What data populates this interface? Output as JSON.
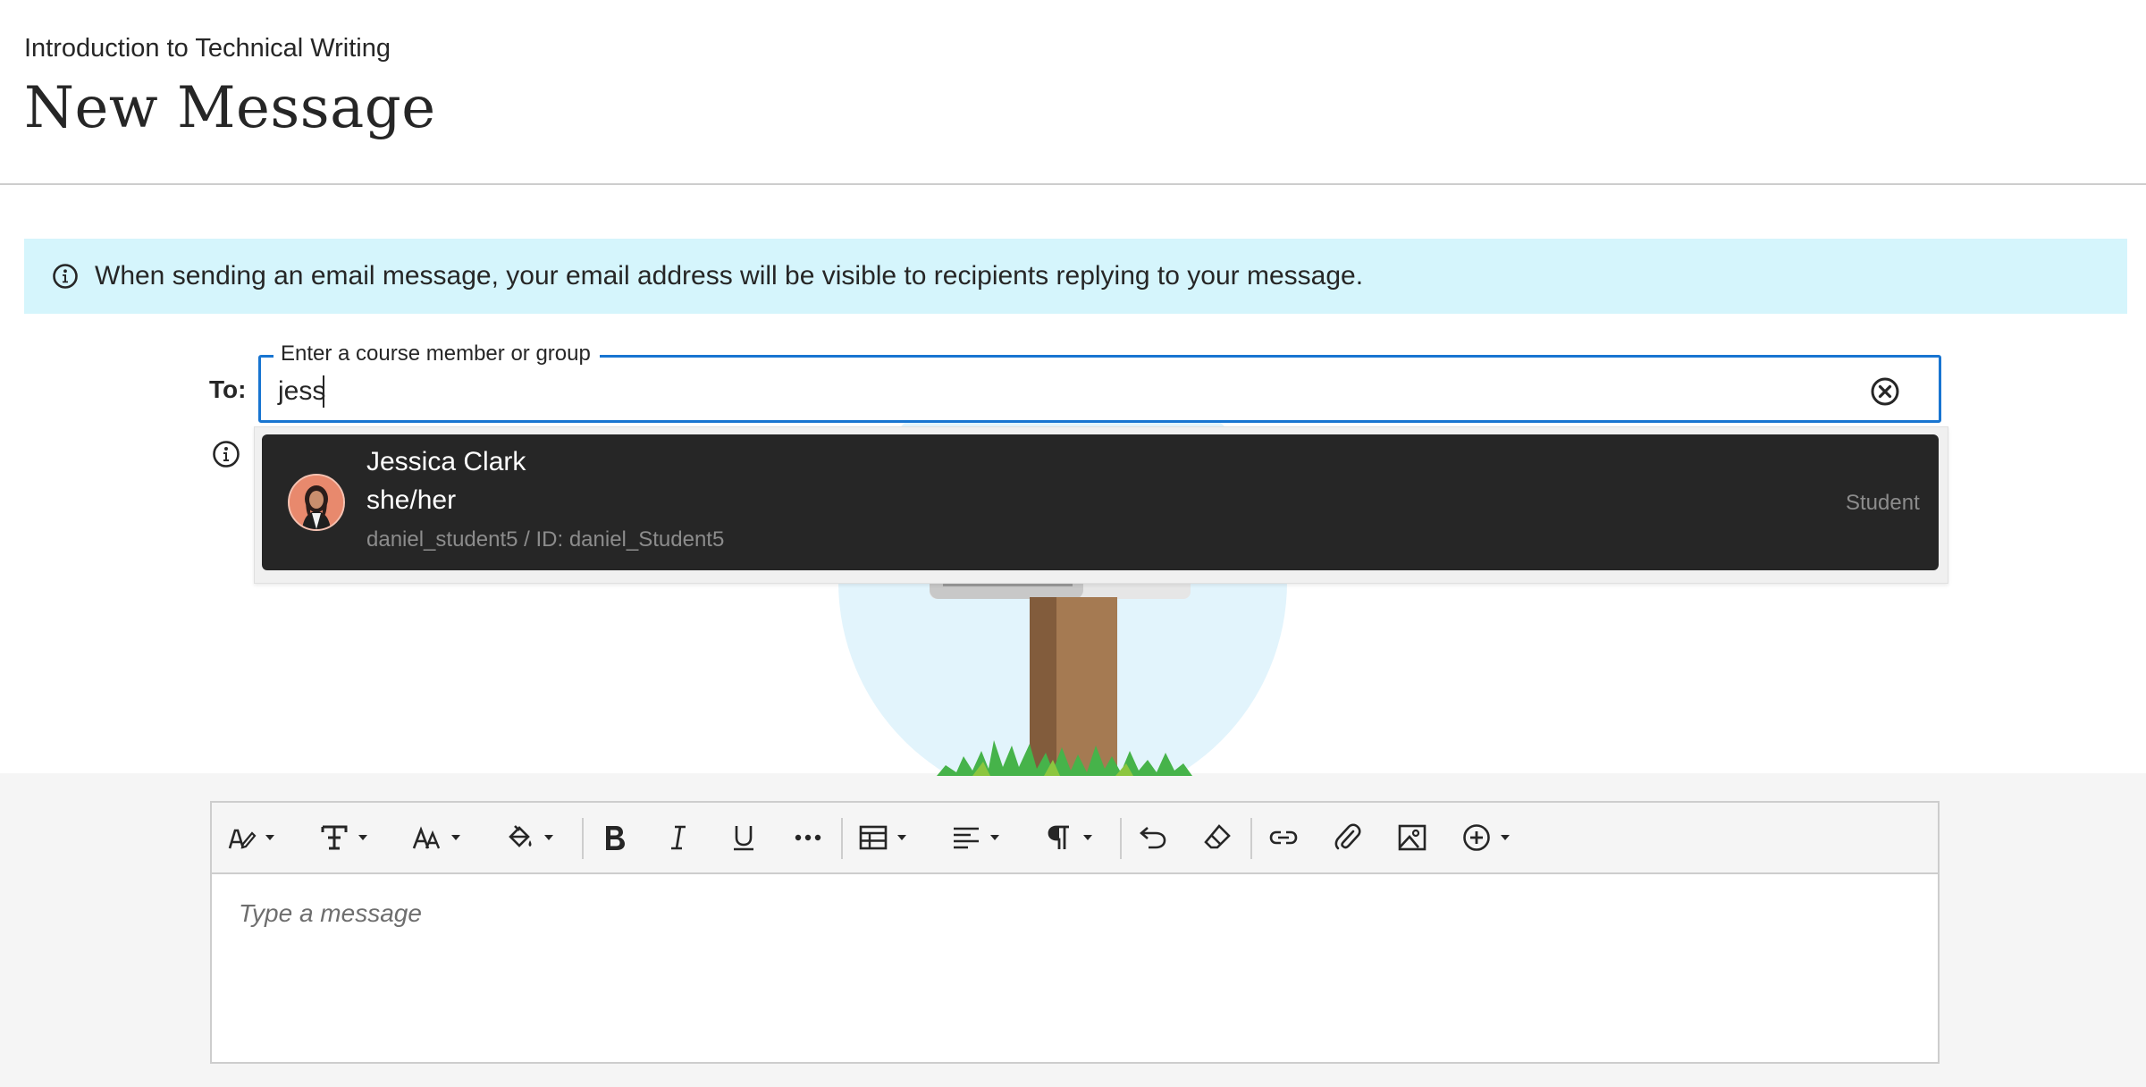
{
  "header": {
    "course_name": "Introduction to Technical Writing",
    "title": "New Message"
  },
  "notice": {
    "icon": "info-icon",
    "text": "When sending an email message, your email address will be visible to recipients replying to your message."
  },
  "recipient": {
    "label": "To:",
    "legend": "Enter a course member or group",
    "value": "jess",
    "clear_icon": "clear-circle-icon"
  },
  "suggestions": [
    {
      "name": "Jessica Clark",
      "pronouns": "she/her",
      "username": "daniel_student5 / ID: daniel_Student5",
      "role": "Student"
    }
  ],
  "editor": {
    "placeholder": "Type a message",
    "toolbar": [
      "text-style-icon",
      "text-format-icon",
      "font-size-icon",
      "fill-color-icon",
      "bold-icon",
      "italic-icon",
      "underline-icon",
      "more-icon",
      "table-icon",
      "align-left-icon",
      "paragraph-icon",
      "undo-icon",
      "clear-format-icon",
      "link-icon",
      "attachment-icon",
      "image-icon",
      "insert-icon"
    ]
  },
  "colors": {
    "accent": "#1875d1",
    "notice_bg": "#d5f5fc",
    "dropdown_bg": "#262626",
    "text": "#262626"
  }
}
